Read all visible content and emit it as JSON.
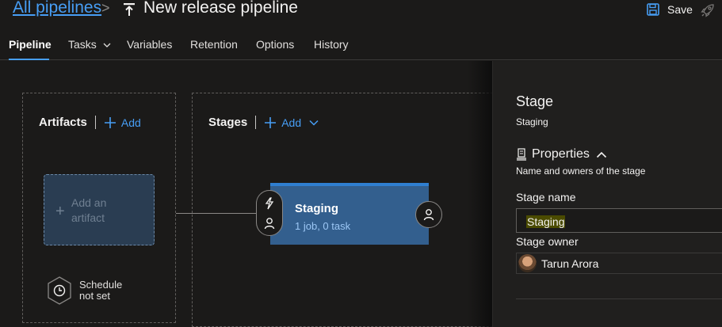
{
  "header": {
    "breadcrumb_link": "All pipelines",
    "breadcrumb_separator": ">",
    "pipeline_icon": "release-pipeline-icon",
    "title": "New release pipeline",
    "save_label": "Save",
    "save_icon": "floppy-disk-icon",
    "release_icon": "rocket-icon"
  },
  "tabs": [
    {
      "label": "Pipeline",
      "active": true
    },
    {
      "label": "Tasks",
      "dropdown": true
    },
    {
      "label": "Variables"
    },
    {
      "label": "Retention"
    },
    {
      "label": "Options"
    },
    {
      "label": "History"
    }
  ],
  "artifacts": {
    "title": "Artifacts",
    "add_label": "Add",
    "card_text_line1": "Add an",
    "card_text_line2": "artifact",
    "schedule_line1": "Schedule",
    "schedule_line2": "not set"
  },
  "stages": {
    "title": "Stages",
    "add_label": "Add",
    "stage": {
      "name": "Staging",
      "summary": "1 job, 0 task"
    }
  },
  "panel": {
    "title": "Stage",
    "subtitle": "Staging",
    "properties_label": "Properties",
    "properties_desc": "Name and owners of the stage",
    "stage_name_label": "Stage name",
    "stage_name_value": "Staging",
    "stage_owner_label": "Stage owner",
    "owner_name": "Tarun Arora"
  },
  "colors": {
    "accent": "#479ef5",
    "stage_card": "#335f8e",
    "background": "#1b1a19",
    "panel": "#201f1e"
  }
}
